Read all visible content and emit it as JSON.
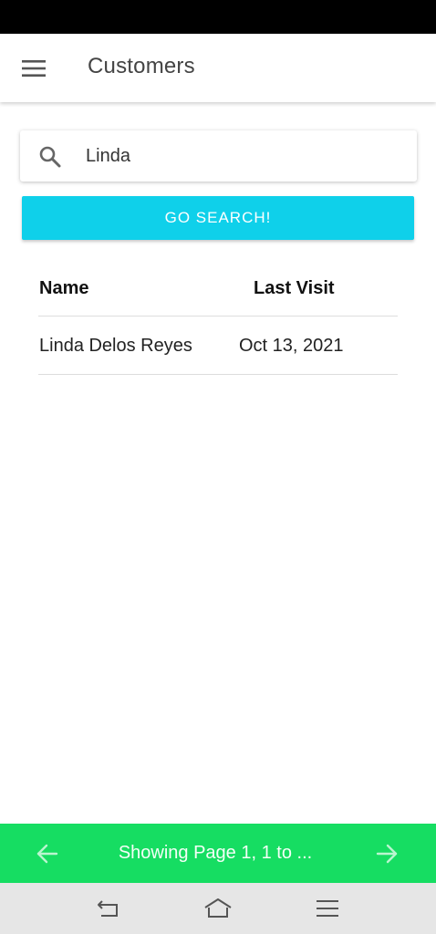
{
  "app_bar": {
    "title": "Customers",
    "menu_icon": "hamburger-menu-icon"
  },
  "search": {
    "icon": "search-icon",
    "value": "Linda",
    "placeholder": ""
  },
  "go_button": {
    "label": "GO SEARCH!"
  },
  "table": {
    "columns": [
      "Name",
      "Last Visit"
    ],
    "rows": [
      {
        "name": "Linda Delos Reyes",
        "last_visit": "Oct 13, 2021"
      }
    ]
  },
  "pager": {
    "text": "Showing Page 1, 1 to ...",
    "prev_icon": "arrow-left-icon",
    "next_icon": "arrow-right-icon"
  },
  "nav_bar": {
    "icons": [
      "back-icon",
      "home-icon",
      "recents-icon"
    ]
  },
  "colors": {
    "status_bar": "#000000",
    "go_button": "#0fd0ea",
    "pager": "#16dd62",
    "nav_bar": "#e6e6e6"
  }
}
